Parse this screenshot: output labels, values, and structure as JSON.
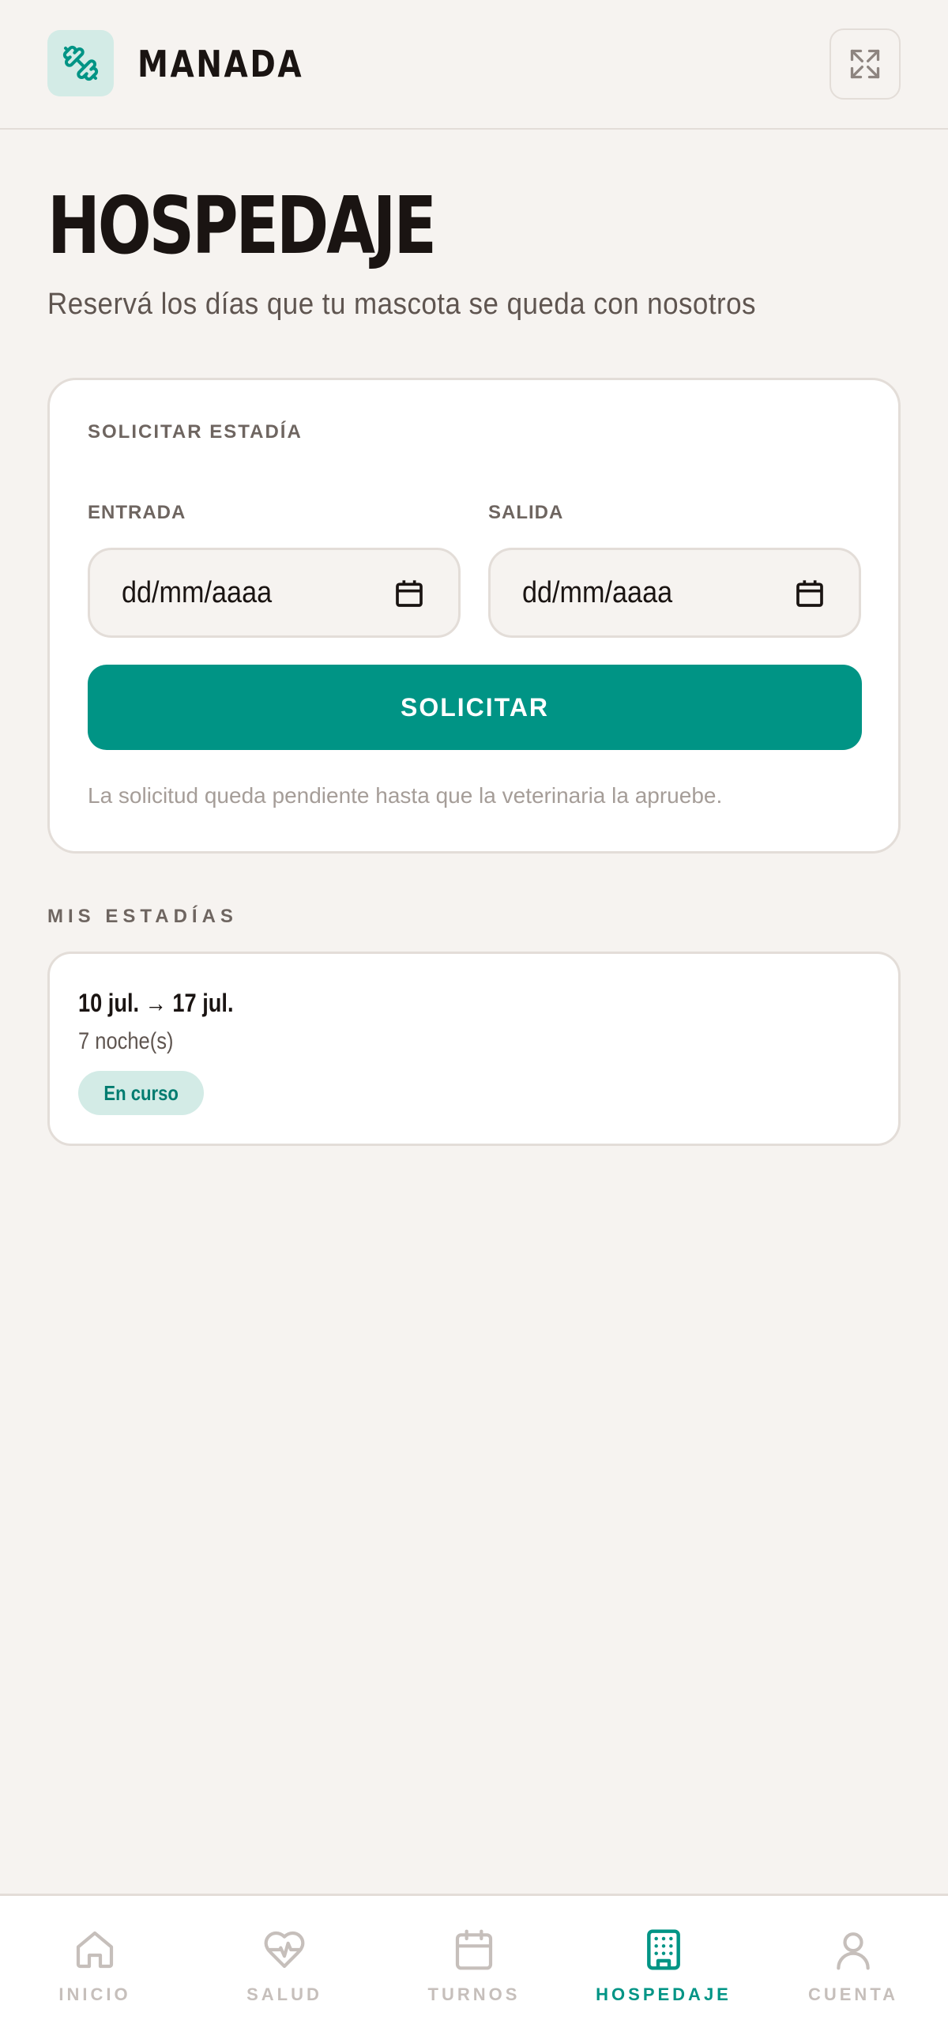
{
  "app": {
    "brand": "MANADA",
    "colors": {
      "accent": "#009485",
      "accent_light": "#d3ebe6",
      "background": "#f6f3f0",
      "border": "#e3ddd8"
    }
  },
  "header": {
    "logo_icon": "dumbbell-icon",
    "fullscreen_icon": "fullscreen-icon"
  },
  "page": {
    "title": "HOSPEDAJE",
    "subtitle": "Reservá los días que tu mascota se queda con nosotros"
  },
  "request_card": {
    "label": "SOLICITAR ESTADÍA",
    "entry": {
      "label": "ENTRADA",
      "placeholder": "dd/mm/aaaa"
    },
    "exit": {
      "label": "SALIDA",
      "placeholder": "dd/mm/aaaa"
    },
    "submit_label": "SOLICITAR",
    "note": "La solicitud queda pendiente hasta que la veterinaria la apruebe."
  },
  "stays": {
    "section_label": "MIS ESTADÍAS",
    "items": [
      {
        "dates": "10 jul. → 17 jul.",
        "nights": "7 noche(s)",
        "status": "En curso"
      }
    ]
  },
  "nav": {
    "items": [
      {
        "label": "INICIO",
        "icon": "home-icon",
        "active": false
      },
      {
        "label": "SALUD",
        "icon": "heart-pulse-icon",
        "active": false
      },
      {
        "label": "TURNOS",
        "icon": "calendar-icon",
        "active": false
      },
      {
        "label": "HOSPEDAJE",
        "icon": "building-icon",
        "active": true
      },
      {
        "label": "CUENTA",
        "icon": "user-icon",
        "active": false
      }
    ]
  }
}
